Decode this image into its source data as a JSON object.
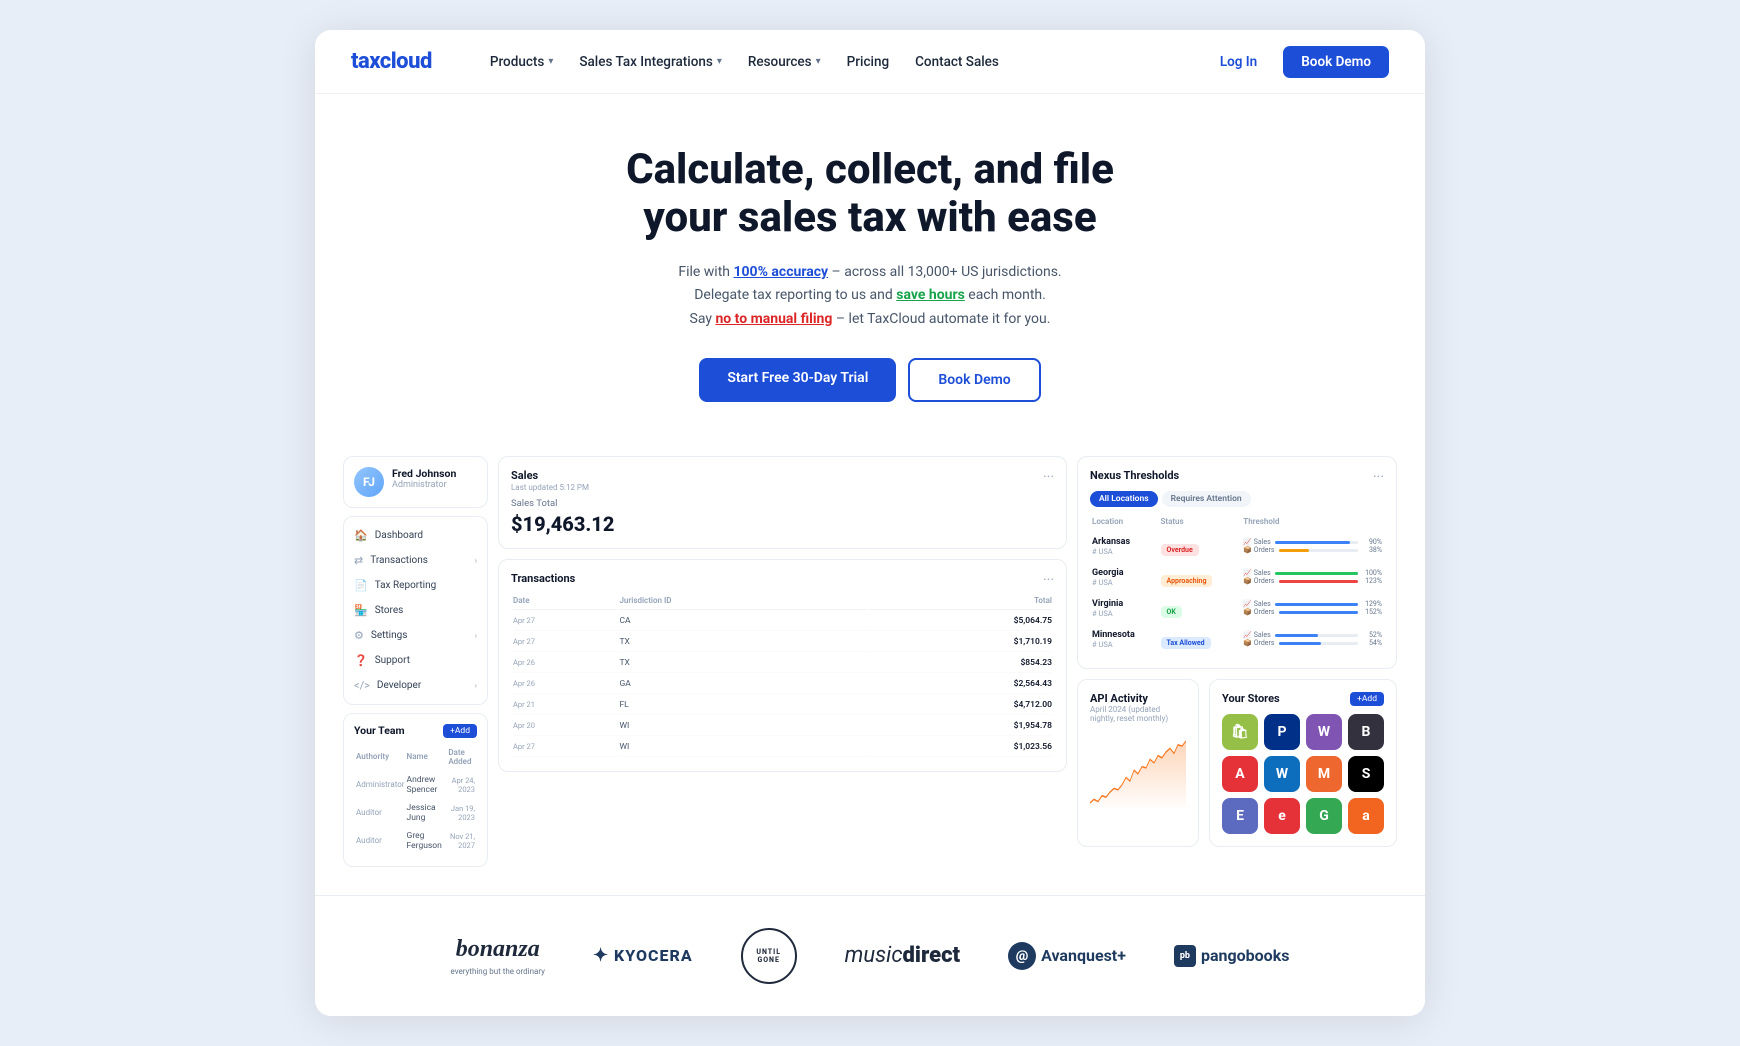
{
  "brand": {
    "name": "taxcloud",
    "logo_text": "taxcloud"
  },
  "nav": {
    "links": [
      {
        "label": "Products",
        "has_dropdown": true
      },
      {
        "label": "Sales Tax Integrations",
        "has_dropdown": true
      },
      {
        "label": "Resources",
        "has_dropdown": true
      },
      {
        "label": "Pricing",
        "has_dropdown": false
      },
      {
        "label": "Contact Sales",
        "has_dropdown": false
      }
    ],
    "login_label": "Log In",
    "demo_label": "Book Demo"
  },
  "hero": {
    "title_line1": "Calculate, collect, and file",
    "title_line2": "your sales tax with ease",
    "desc_line1": "File with 100% accuracy – across all 13,000+ US jurisdictions.",
    "desc_line2": "Delegate tax reporting to us and save hours each month.",
    "desc_line3": "Say no to manual filing – let TaxCloud automate it for you.",
    "cta_trial": "Start Free 30-Day Trial",
    "cta_demo": "Book Demo"
  },
  "dashboard": {
    "user": {
      "name": "Fred Johnson",
      "role": "Administrator"
    },
    "nav_items": [
      {
        "label": "Dashboard",
        "icon": "🏠"
      },
      {
        "label": "Transactions",
        "icon": "⇄",
        "has_arrow": true
      },
      {
        "label": "Tax Reporting",
        "icon": "📄"
      },
      {
        "label": "Stores",
        "icon": "🏪"
      },
      {
        "label": "Settings",
        "icon": "⚙",
        "has_arrow": true
      },
      {
        "label": "Support",
        "icon": "❓"
      },
      {
        "label": "Developer",
        "icon": "</>",
        "has_arrow": true
      }
    ],
    "team": {
      "title": "Your Team",
      "add_label": "+Add",
      "columns": [
        "Authority",
        "Name",
        "Date Added"
      ],
      "rows": [
        {
          "authority": "Administrator",
          "name": "Andrew Spencer",
          "date": "Apr 24, 2023"
        },
        {
          "authority": "Auditor",
          "name": "Jessica Jung",
          "date": "Jan 19, 2023"
        },
        {
          "authority": "Auditor",
          "name": "Greg Ferguson",
          "date": "Nov 21, 2027"
        }
      ]
    },
    "sales": {
      "title": "Sales",
      "subtitle": "Last updated 5:12 PM",
      "total_label": "Sales Total",
      "total_value": "$19,463.12"
    },
    "transactions": {
      "title": "Transactions",
      "columns": [
        "Date",
        "Jurisdiction ID",
        "Total"
      ],
      "rows": [
        {
          "date": "Apr 27",
          "jurisdiction": "CA",
          "total": "$5,064.75"
        },
        {
          "date": "Apr 27",
          "jurisdiction": "TX",
          "total": "$1,710.19"
        },
        {
          "date": "Apr 26",
          "jurisdiction": "TX",
          "total": "$854.23"
        },
        {
          "date": "Apr 26",
          "jurisdiction": "GA",
          "total": "$2,564.43"
        },
        {
          "date": "Apr 21",
          "jurisdiction": "FL",
          "total": "$4,712.00"
        },
        {
          "date": "Apr 20",
          "jurisdiction": "WI",
          "total": "$1,954.78"
        },
        {
          "date": "Apr 27",
          "jurisdiction": "WI",
          "total": "$1,023.56"
        }
      ]
    },
    "nexus": {
      "title": "Nexus Thresholds",
      "tabs": [
        "All Locations",
        "Requires Attention"
      ],
      "columns": [
        "Location",
        "Status",
        "Threshold"
      ],
      "rows": [
        {
          "location": "Arkansas",
          "sub": "# USA",
          "status": "Overdue",
          "status_type": "red",
          "sales_pct": 90,
          "orders_pct": 38,
          "sales_color": "#3b82f6",
          "orders_color": "#f59e0b"
        },
        {
          "location": "Georgia",
          "sub": "# USA",
          "status": "Approaching",
          "status_type": "orange",
          "sales_pct": 100,
          "orders_pct": 123,
          "sales_color": "#22c55e",
          "orders_color": "#ef4444"
        },
        {
          "location": "Virginia",
          "sub": "# USA",
          "status": "OK",
          "status_type": "green",
          "sales_pct": 129,
          "orders_pct": 152,
          "sales_color": "#3b82f6",
          "orders_color": "#3b82f6"
        },
        {
          "location": "Minnesota",
          "sub": "# USA",
          "status": "Tax Allowed",
          "status_type": "blue",
          "sales_pct": 52,
          "orders_pct": 54,
          "sales_color": "#3b82f6",
          "orders_color": "#3b82f6"
        }
      ]
    },
    "api": {
      "title": "API Activity",
      "subtitle": "April 2024 (updated nightly, reset monthly)",
      "chart_points": [
        10,
        15,
        12,
        20,
        18,
        25,
        30,
        28,
        35,
        45,
        40,
        55,
        50,
        60,
        58,
        70,
        65,
        75,
        72,
        80,
        85,
        78,
        90,
        88,
        95
      ]
    },
    "stores": {
      "title": "Your Stores",
      "add_label": "+Add",
      "icons": [
        {
          "name": "Shopify",
          "class": "shopify",
          "symbol": "🛍"
        },
        {
          "name": "PayPal",
          "class": "paypal",
          "symbol": "P"
        },
        {
          "name": "WooCommerce",
          "class": "woocommerce",
          "symbol": "W"
        },
        {
          "name": "BigCommerce",
          "class": "bigcommerce",
          "symbol": "B"
        },
        {
          "name": "Amazon",
          "class": "amazon",
          "symbol": "A"
        },
        {
          "name": "Wix",
          "class": "wix",
          "symbol": "W"
        },
        {
          "name": "Magento",
          "class": "magento",
          "symbol": "M"
        },
        {
          "name": "Squarespace",
          "class": "squarespace",
          "symbol": "S"
        },
        {
          "name": "Etsy",
          "class": "shopify2",
          "symbol": "E"
        },
        {
          "name": "eBay",
          "class": "ebay",
          "symbol": "e"
        },
        {
          "name": "Google",
          "class": "google",
          "symbol": "G"
        },
        {
          "name": "Other",
          "class": "etsy",
          "symbol": "a"
        }
      ]
    }
  },
  "logos": [
    {
      "name": "bonanza",
      "text": "bonanza",
      "sub": "everything but the ordinary"
    },
    {
      "name": "kyocera",
      "text": "KYOCERA"
    },
    {
      "name": "until-gone",
      "text": "UNTIL GONE"
    },
    {
      "name": "music-direct",
      "text": "music direct"
    },
    {
      "name": "avanquest",
      "text": "Avanquest+"
    },
    {
      "name": "pangobooks",
      "text": "pb pangobooks"
    }
  ]
}
